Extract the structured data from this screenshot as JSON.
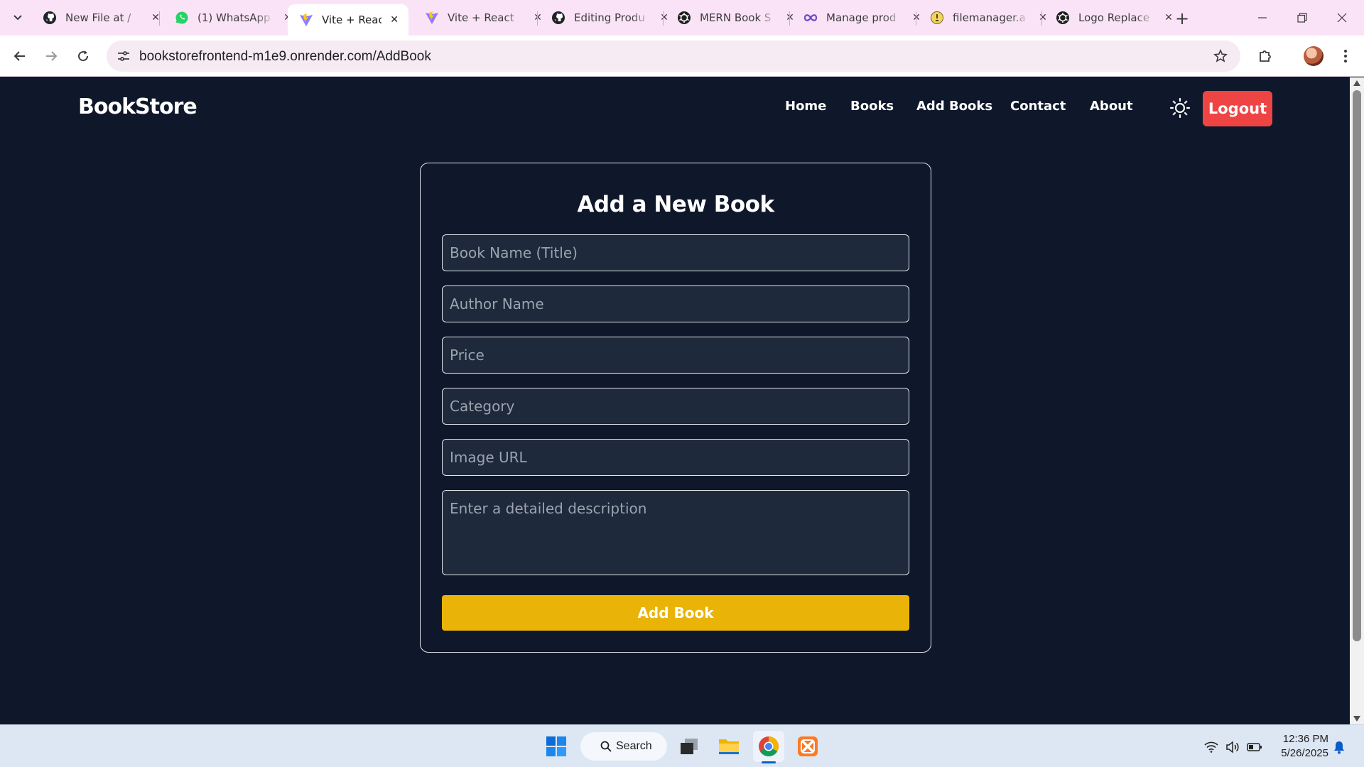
{
  "browser": {
    "tabs": [
      {
        "title": "New File at /",
        "icon": "github-icon",
        "active": false
      },
      {
        "title": "(1) WhatsApp",
        "icon": "whatsapp-icon",
        "active": false
      },
      {
        "title": "Vite + React",
        "icon": "vite-icon",
        "active": true
      },
      {
        "title": "Vite + React",
        "icon": "vite-icon",
        "active": false
      },
      {
        "title": "Editing Produ",
        "icon": "github-icon",
        "active": false
      },
      {
        "title": "MERN Book S",
        "icon": "chatgpt-icon",
        "active": false
      },
      {
        "title": "Manage prod",
        "icon": "infinity-icon",
        "active": false
      },
      {
        "title": "filemanager.a",
        "icon": "lightbulb-icon",
        "active": false
      },
      {
        "title": "Logo Replace",
        "icon": "chatgpt-icon",
        "active": false
      }
    ],
    "url": "bookstorefrontend-m1e9.onrender.com/AddBook"
  },
  "navbar": {
    "brand": "BookStore",
    "links": [
      "Home",
      "Books",
      "Add Books",
      "Contact",
      "About"
    ],
    "logout_label": "Logout"
  },
  "form": {
    "title": "Add a New Book",
    "placeholders": {
      "title": "Book Name (Title)",
      "author": "Author Name",
      "price": "Price",
      "category": "Category",
      "image": "Image URL",
      "description": "Enter a detailed description"
    },
    "submit_label": "Add Book"
  },
  "taskbar": {
    "search_label": "Search",
    "time": "12:36 PM",
    "date": "5/26/2025"
  },
  "colors": {
    "page_bg": "#0f172a",
    "input_bg": "#1e293b",
    "logout": "#ef4444",
    "submit": "#eab308",
    "tabstrip": "#fbe3f7"
  }
}
